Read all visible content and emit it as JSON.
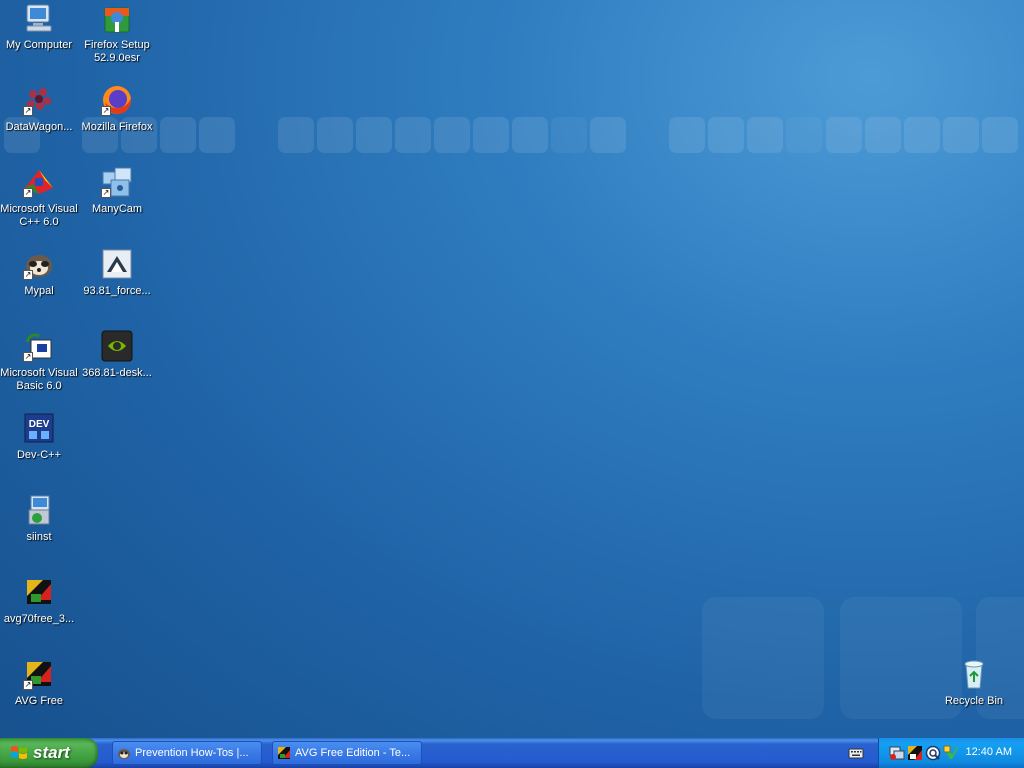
{
  "desktop": {
    "icons": [
      {
        "id": "my-computer",
        "label": "My Computer",
        "icon": "computer-icon"
      },
      {
        "id": "firefox-setup",
        "label": "Firefox Setup\n52.9.0esr",
        "icon": "firefox-setup-icon"
      },
      {
        "id": "datawagon",
        "label": "DataWagon...",
        "icon": "datawagon-icon"
      },
      {
        "id": "mozilla-firefox",
        "label": "Mozilla Firefox",
        "icon": "firefox-icon"
      },
      {
        "id": "ms-visual-cpp",
        "label": "Microsoft Visual\nC++ 6.0",
        "icon": "visual-cpp-icon"
      },
      {
        "id": "manycam",
        "label": "ManyCam",
        "icon": "manycam-icon"
      },
      {
        "id": "mypal",
        "label": "Mypal",
        "icon": "mypal-icon"
      },
      {
        "id": "force-file",
        "label": "93.81_force...",
        "icon": "installer-icon"
      },
      {
        "id": "ms-visual-basic",
        "label": "Microsoft Visual\nBasic 6.0",
        "icon": "visual-basic-icon"
      },
      {
        "id": "nvidia-desk",
        "label": "368.81-desk...",
        "icon": "nvidia-icon"
      },
      {
        "id": "dev-cpp",
        "label": "Dev-C++",
        "icon": "dev-cpp-icon"
      },
      {
        "id": "siinst",
        "label": "siinst",
        "icon": "setup-icon"
      },
      {
        "id": "avg70free",
        "label": "avg70free_3...",
        "icon": "avg-installer-icon"
      },
      {
        "id": "avg-free",
        "label": "AVG Free",
        "icon": "avg-icon"
      },
      {
        "id": "recycle-bin",
        "label": "Recycle Bin",
        "icon": "recycle-bin-icon"
      }
    ]
  },
  "taskbar": {
    "start_label": "start",
    "tasks": [
      {
        "label": "Prevention How-Tos |...",
        "icon": "mypal-icon"
      },
      {
        "label": "AVG Free Edition - Te...",
        "icon": "avg-icon"
      }
    ],
    "clock": "12:40 AM"
  },
  "colors": {
    "desktop_bg": "#1f63a6",
    "taskbar": "#245bd0",
    "start_green": "#3a9a3a",
    "tray": "#0f8ae0"
  }
}
